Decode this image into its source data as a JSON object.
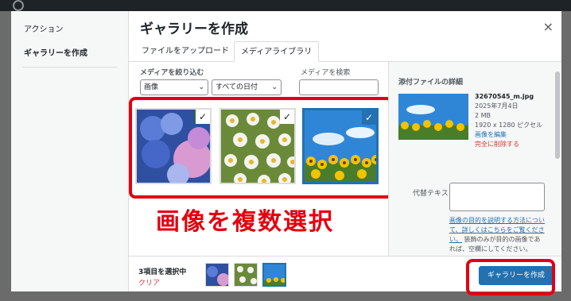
{
  "menu": {
    "section_title": "アクション",
    "active_item": "ギャラリーを作成"
  },
  "header": {
    "title": "ギャラリーを作成",
    "close_icon": "×"
  },
  "tabs": [
    {
      "label": "ファイルをアップロード"
    },
    {
      "label": "メディアライブラリ"
    }
  ],
  "toolbar": {
    "filter_label": "メディアを絞り込む",
    "type_select": "画像",
    "date_select": "すべての日付",
    "search_label": "メディアを検索"
  },
  "attachments": [
    {
      "name": "hydrangea",
      "selected": true
    },
    {
      "name": "daisies",
      "selected": true
    },
    {
      "name": "sunflowers",
      "selected": true
    }
  ],
  "annotation": {
    "text": "画像を複数選択",
    "color": "#e3000f"
  },
  "sidebar": {
    "heading": "添付ファイルの詳細",
    "filename": "32670545_m.jpg",
    "date": "2025年7月4日",
    "size": "2 MB",
    "dimensions": "1920 x 1280 ピクセル",
    "edit_link": "画像を編集",
    "delete_link": "完全に削除する",
    "alt_label": "代替テキスト",
    "help_link": "画像の目的を説明する方法について、詳しくはこちらをご覧ください。",
    "help_text": "装飾のみが目的の画像であれば、空欄にしてください。"
  },
  "footer": {
    "selected_count": "3項目を選択中",
    "clear_label": "クリア",
    "primary_button": "ギャラリーを作成"
  },
  "colors": {
    "accent": "#2271b1",
    "danger": "#d63638"
  }
}
